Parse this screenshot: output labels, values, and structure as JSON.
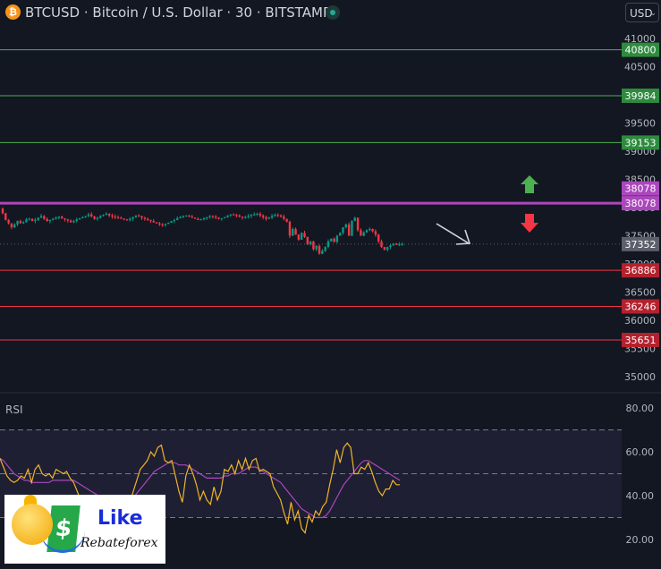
{
  "header": {
    "symbol_icon": "bitcoin-icon",
    "title": "BTCUSD · Bitcoin / U.S. Dollar · 30 · BITSTAMP",
    "market_status": "open",
    "currency": "USD",
    "currency_chevron": "⌄"
  },
  "colors": {
    "background": "#131722",
    "up": "#089981",
    "down": "#f23645",
    "resistance": "#4caf50",
    "support": "#f23645",
    "pivot": "#ab47bc",
    "rsi_line": "#f0b429",
    "rsi_ma": "#ab47bc",
    "current_price_label": "#5d606b"
  },
  "chart_data": [
    {
      "type": "candlestick",
      "title": "BTCUSD · Bitcoin / U.S. Dollar · 30 · BITSTAMP",
      "ylim": [
        34700,
        41300
      ],
      "yticks": [
        35000,
        35500,
        36000,
        36500,
        37000,
        37500,
        38000,
        38500,
        39000,
        39500,
        40000,
        40500,
        41000
      ],
      "current_price": 37352,
      "horizontal_levels": [
        {
          "price": 40800,
          "label": "40800",
          "kind": "resistance"
        },
        {
          "price": 39984,
          "label": "39984",
          "kind": "resistance"
        },
        {
          "price": 39153,
          "label": "39153",
          "kind": "resistance"
        },
        {
          "price": 38078,
          "label": "38078",
          "kind": "pivot"
        },
        {
          "price": 36886,
          "label": "36886",
          "kind": "support"
        },
        {
          "price": 36246,
          "label": "36246",
          "kind": "support"
        },
        {
          "price": 35651,
          "label": "35651",
          "kind": "support"
        }
      ],
      "pivot_label_secondary": "38078",
      "annotations": [
        {
          "type": "arrow-up",
          "color": "green"
        },
        {
          "type": "arrow-down",
          "color": "red"
        },
        {
          "type": "trend-arrow",
          "direction": "down-right",
          "color": "white"
        }
      ],
      "candles_close": [
        37900,
        37780,
        37720,
        37650,
        37700,
        37760,
        37720,
        37740,
        37790,
        37800,
        37760,
        37780,
        37820,
        37850,
        37800,
        37760,
        37780,
        37800,
        37820,
        37840,
        37810,
        37790,
        37770,
        37740,
        37760,
        37790,
        37810,
        37830,
        37850,
        37880,
        37840,
        37800,
        37820,
        37850,
        37870,
        37890,
        37860,
        37840,
        37830,
        37820,
        37800,
        37790,
        37780,
        37800,
        37830,
        37860,
        37850,
        37820,
        37800,
        37780,
        37760,
        37740,
        37720,
        37700,
        37690,
        37710,
        37730,
        37760,
        37780,
        37810,
        37830,
        37850,
        37860,
        37840,
        37820,
        37800,
        37780,
        37790,
        37810,
        37830,
        37850,
        37840,
        37820,
        37800,
        37810,
        37830,
        37860,
        37880,
        37870,
        37860,
        37840,
        37820,
        37830,
        37850,
        37870,
        37880,
        37890,
        37860,
        37830,
        37800,
        37820,
        37850,
        37870,
        37860,
        37840,
        37800,
        37750,
        37500,
        37620,
        37520,
        37430,
        37550,
        37480,
        37350,
        37400,
        37260,
        37320,
        37180,
        37230,
        37300,
        37400,
        37450,
        37390,
        37500,
        37550,
        37650,
        37700,
        37500,
        37760,
        37820,
        37600,
        37500,
        37560,
        37600,
        37620,
        37580,
        37520,
        37400,
        37300,
        37250,
        37300,
        37330,
        37360,
        37340,
        37350,
        37352
      ],
      "rsi": {
        "name": "RSI",
        "ylim": [
          15,
          85
        ],
        "yticks": [
          20,
          40,
          60,
          80
        ],
        "bands": [
          30,
          50,
          70
        ],
        "rsi_values": [
          57,
          53,
          49,
          47,
          46,
          47,
          49,
          48,
          52,
          46,
          52,
          54,
          50,
          49,
          50,
          48,
          52,
          51,
          50,
          51,
          48,
          46,
          42,
          38,
          40,
          33,
          34,
          31,
          27,
          24,
          27,
          30,
          36,
          33,
          38,
          35,
          31,
          36,
          42,
          47,
          52,
          54,
          56,
          60,
          58,
          62,
          63,
          56,
          55,
          56,
          49,
          42,
          37,
          49,
          54,
          50,
          45,
          38,
          42,
          38,
          36,
          44,
          38,
          42,
          52,
          51,
          54,
          50,
          56,
          52,
          57,
          52,
          56,
          57,
          51,
          52,
          51,
          50,
          44,
          41,
          38,
          32,
          27,
          37,
          29,
          33,
          25,
          23,
          31,
          28,
          33,
          31,
          35,
          37,
          45,
          52,
          61,
          55,
          62,
          64,
          62,
          50,
          50,
          53,
          52,
          55,
          51,
          46,
          42,
          40,
          43,
          43,
          47,
          45,
          45
        ],
        "ma_values": [
          57,
          56,
          54,
          52,
          50,
          49,
          48,
          47,
          47,
          46,
          46,
          46,
          46,
          46,
          46,
          47,
          47,
          47,
          47,
          47,
          47,
          47,
          46,
          45,
          44,
          43,
          42,
          41,
          40,
          39,
          38,
          37,
          36,
          36,
          36,
          36,
          37,
          38,
          39,
          41,
          43,
          45,
          47,
          49,
          51,
          52,
          53,
          54,
          55,
          55,
          55,
          54,
          54,
          54,
          53,
          52,
          51,
          50,
          49,
          48,
          48,
          48,
          48,
          48,
          49,
          49,
          50,
          50,
          50,
          51,
          52,
          53,
          53,
          53,
          52,
          51,
          50,
          49,
          48,
          47,
          46,
          44,
          42,
          40,
          38,
          36,
          34,
          33,
          32,
          31,
          30,
          30,
          30,
          31,
          33,
          36,
          39,
          42,
          45,
          47,
          49,
          51,
          53,
          55,
          56,
          56,
          55,
          54,
          53,
          52,
          51,
          50,
          49,
          48,
          47
        ]
      }
    }
  ],
  "rsi_pane": {
    "label": "RSI"
  },
  "watermark": {
    "logo_label": "Like",
    "logo_sub": "Rebateforex",
    "logo_icon": "thumbs-up-smiley-icon"
  }
}
